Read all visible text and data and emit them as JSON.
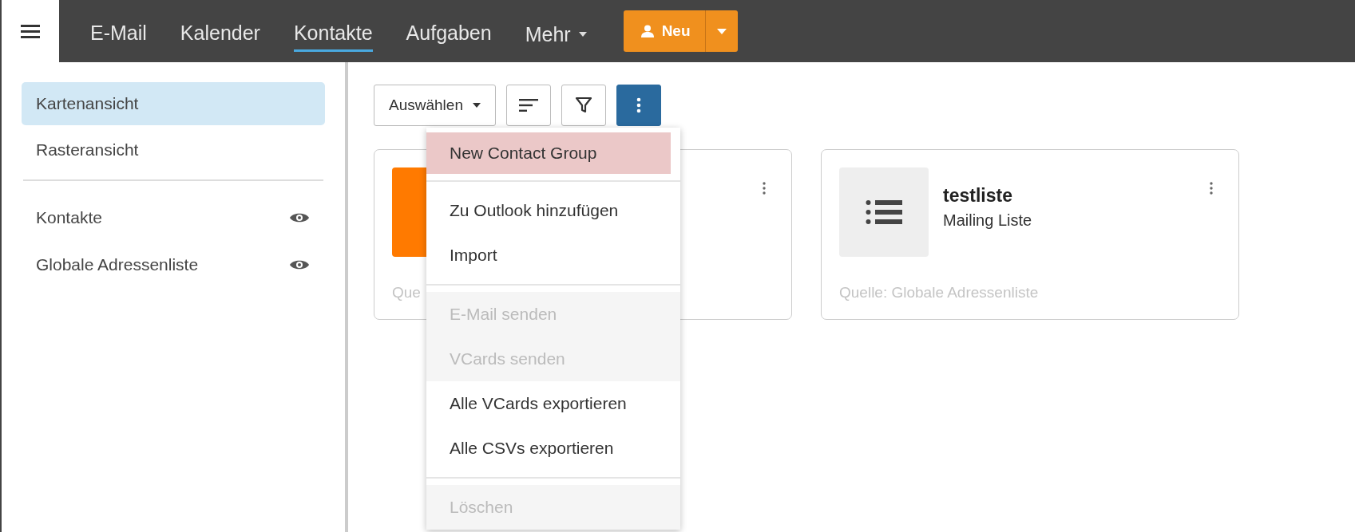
{
  "nav": {
    "tabs": [
      {
        "label": "E-Mail",
        "selected": false
      },
      {
        "label": "Kalender",
        "selected": false
      },
      {
        "label": "Kontakte",
        "selected": true
      },
      {
        "label": "Aufgaben",
        "selected": false
      }
    ],
    "more": {
      "label": "Mehr"
    },
    "new_button": {
      "label": "Neu"
    }
  },
  "sidebar": {
    "views": [
      {
        "label": "Kartenansicht",
        "selected": true
      },
      {
        "label": "Rasteransicht",
        "selected": false
      }
    ],
    "sources": [
      {
        "label": "Kontakte",
        "visible": true
      },
      {
        "label": "Globale Adressenliste",
        "visible": true
      }
    ]
  },
  "toolbar": {
    "select_button": {
      "label": "Auswählen"
    }
  },
  "cards": [
    {
      "kind": "contact",
      "source": "Que"
    },
    {
      "kind": "list",
      "title": "testliste",
      "subtitle": "Mailing Liste",
      "source": "Quelle: Globale Adressenliste"
    }
  ],
  "menu": [
    [
      {
        "label": "New Contact Group",
        "disabled": false,
        "highlighted": true
      }
    ],
    [
      {
        "label": "Zu Outlook hinzufügen",
        "disabled": false,
        "highlighted": false
      },
      {
        "label": "Import",
        "disabled": false,
        "highlighted": false
      }
    ],
    [
      {
        "label": "E-Mail senden",
        "disabled": true,
        "highlighted": false
      },
      {
        "label": "VCards senden",
        "disabled": true,
        "highlighted": false
      },
      {
        "label": "Alle VCards exportieren",
        "disabled": false,
        "highlighted": false
      },
      {
        "label": "Alle CSVs exportieren",
        "disabled": false,
        "highlighted": false
      }
    ],
    [
      {
        "label": "Löschen",
        "disabled": true,
        "highlighted": false
      }
    ]
  ]
}
